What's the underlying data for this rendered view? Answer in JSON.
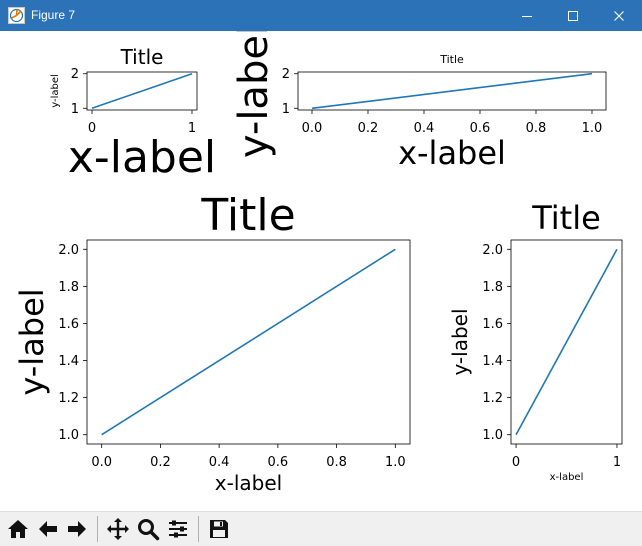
{
  "window": {
    "title": "Figure 7",
    "icons": {
      "app": "matplotlib-figure-icon",
      "minimize": "minimize-icon",
      "maximize": "maximize-icon",
      "close": "close-icon"
    }
  },
  "toolbar": {
    "buttons": [
      {
        "name": "home-icon",
        "tooltip": "Reset original view"
      },
      {
        "name": "back-arrow-icon",
        "tooltip": "Back"
      },
      {
        "name": "forward-arrow-icon",
        "tooltip": "Forward"
      },
      {
        "name": "pan-move-icon",
        "tooltip": "Pan"
      },
      {
        "name": "zoom-magnifier-icon",
        "tooltip": "Zoom"
      },
      {
        "name": "configure-subplots-icon",
        "tooltip": "Configure subplots"
      },
      {
        "name": "save-disk-icon",
        "tooltip": "Save"
      }
    ]
  },
  "chart_data": [
    {
      "type": "line",
      "title": "Title",
      "xlabel": "x-label",
      "ylabel": "y-label",
      "x": [
        0,
        1
      ],
      "y": [
        1,
        2
      ],
      "xlim": [
        -0.05,
        1.05
      ],
      "ylim": [
        0.95,
        2.05
      ],
      "xticks": [
        "0",
        "1"
      ],
      "yticks": [
        "1",
        "2"
      ],
      "color": "#1f77b4"
    },
    {
      "type": "line",
      "title": "Title",
      "xlabel": "x-label",
      "ylabel": "y-label",
      "x": [
        0,
        1
      ],
      "y": [
        1,
        2
      ],
      "xlim": [
        -0.05,
        1.05
      ],
      "ylim": [
        0.95,
        2.05
      ],
      "xticks": [
        "0.0",
        "0.2",
        "0.4",
        "0.6",
        "0.8",
        "1.0"
      ],
      "yticks": [
        "1",
        "2"
      ],
      "color": "#1f77b4"
    },
    {
      "type": "line",
      "title": "Title",
      "xlabel": "x-label",
      "ylabel": "y-label",
      "x": [
        0,
        1
      ],
      "y": [
        1,
        2
      ],
      "xlim": [
        -0.05,
        1.05
      ],
      "ylim": [
        0.95,
        2.05
      ],
      "xticks": [
        "0.0",
        "0.2",
        "0.4",
        "0.6",
        "0.8",
        "1.0"
      ],
      "yticks": [
        "1.0",
        "1.2",
        "1.4",
        "1.6",
        "1.8",
        "2.0"
      ],
      "color": "#1f77b4"
    },
    {
      "type": "line",
      "title": "Title",
      "xlabel": "x-label",
      "ylabel": "y-label",
      "x": [
        0,
        1
      ],
      "y": [
        1,
        2
      ],
      "xlim": [
        -0.05,
        1.05
      ],
      "ylim": [
        0.95,
        2.05
      ],
      "xticks": [
        "0",
        "1"
      ],
      "yticks": [
        "1.0",
        "1.2",
        "1.4",
        "1.6",
        "1.8",
        "2.0"
      ],
      "color": "#1f77b4"
    }
  ]
}
